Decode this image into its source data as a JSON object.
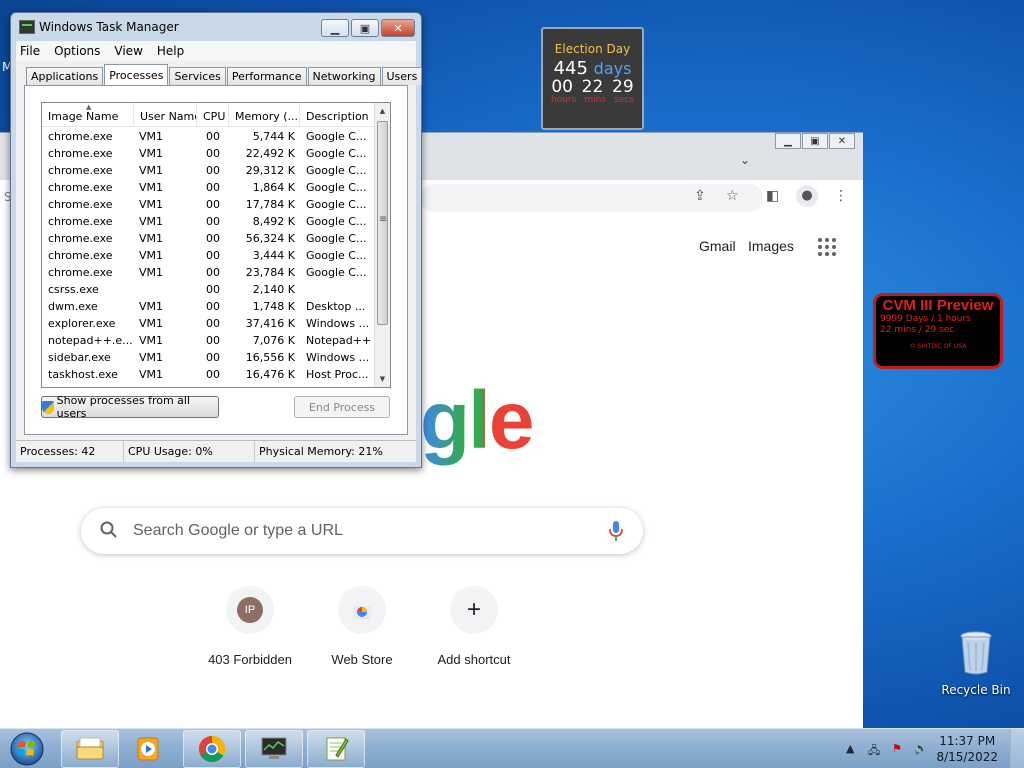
{
  "desktop": {
    "edge_letter": "M",
    "recycle_bin_label": "Recycle Bin"
  },
  "gadget_election": {
    "title": "Election Day",
    "days_value": "445",
    "days_unit": "days",
    "hours": "00",
    "mins": "22",
    "secs": "29",
    "hours_label": "hours",
    "mins_label": "mins",
    "secs_label": "secs"
  },
  "gadget_cvm": {
    "title": "CVM III Preview",
    "line1": "9999 Days / 1 hours",
    "line2": "22 mins / 29 sec",
    "copyright": "© SHITDIC OF USA"
  },
  "chrome": {
    "gmail": "Gmail",
    "images": "Images",
    "search_placeholder": "Search Google or type a URL",
    "logo_partial": "gle",
    "shortcuts": [
      {
        "label": "403 Forbidden",
        "initials": "IP"
      },
      {
        "label": "Web Store"
      },
      {
        "label": "Add shortcut",
        "symbol": "+"
      }
    ],
    "cut_letter": "S"
  },
  "task_manager": {
    "title": "Windows Task Manager",
    "menu": [
      "File",
      "Options",
      "View",
      "Help"
    ],
    "tabs": [
      "Applications",
      "Processes",
      "Services",
      "Performance",
      "Networking",
      "Users"
    ],
    "active_tab": "Processes",
    "columns": [
      "Image Name",
      "User Name",
      "CPU",
      "Memory (...",
      "Description"
    ],
    "rows": [
      [
        "chrome.exe",
        "VM1",
        "00",
        "5,744 K",
        "Google C..."
      ],
      [
        "chrome.exe",
        "VM1",
        "00",
        "22,492 K",
        "Google C..."
      ],
      [
        "chrome.exe",
        "VM1",
        "00",
        "29,312 K",
        "Google C..."
      ],
      [
        "chrome.exe",
        "VM1",
        "00",
        "1,864 K",
        "Google C..."
      ],
      [
        "chrome.exe",
        "VM1",
        "00",
        "17,784 K",
        "Google C..."
      ],
      [
        "chrome.exe",
        "VM1",
        "00",
        "8,492 K",
        "Google C..."
      ],
      [
        "chrome.exe",
        "VM1",
        "00",
        "56,324 K",
        "Google C..."
      ],
      [
        "chrome.exe",
        "VM1",
        "00",
        "3,444 K",
        "Google C..."
      ],
      [
        "chrome.exe",
        "VM1",
        "00",
        "23,784 K",
        "Google C..."
      ],
      [
        "csrss.exe",
        "",
        "00",
        "2,140 K",
        ""
      ],
      [
        "dwm.exe",
        "VM1",
        "00",
        "1,748 K",
        "Desktop ..."
      ],
      [
        "explorer.exe",
        "VM1",
        "00",
        "37,416 K",
        "Windows ..."
      ],
      [
        "notepad++.e...",
        "VM1",
        "00",
        "7,076 K",
        "Notepad++"
      ],
      [
        "sidebar.exe",
        "VM1",
        "00",
        "16,556 K",
        "Windows ..."
      ],
      [
        "taskhost.exe",
        "VM1",
        "00",
        "16,476 K",
        "Host Proc..."
      ]
    ],
    "show_all_button": "Show processes from all users",
    "end_process_button": "End Process",
    "status_processes": "Processes: 42",
    "status_cpu": "CPU Usage: 0%",
    "status_memory": "Physical Memory: 21%"
  },
  "taskbar": {
    "clock_time": "11:37 PM",
    "clock_date": "8/15/2022"
  }
}
